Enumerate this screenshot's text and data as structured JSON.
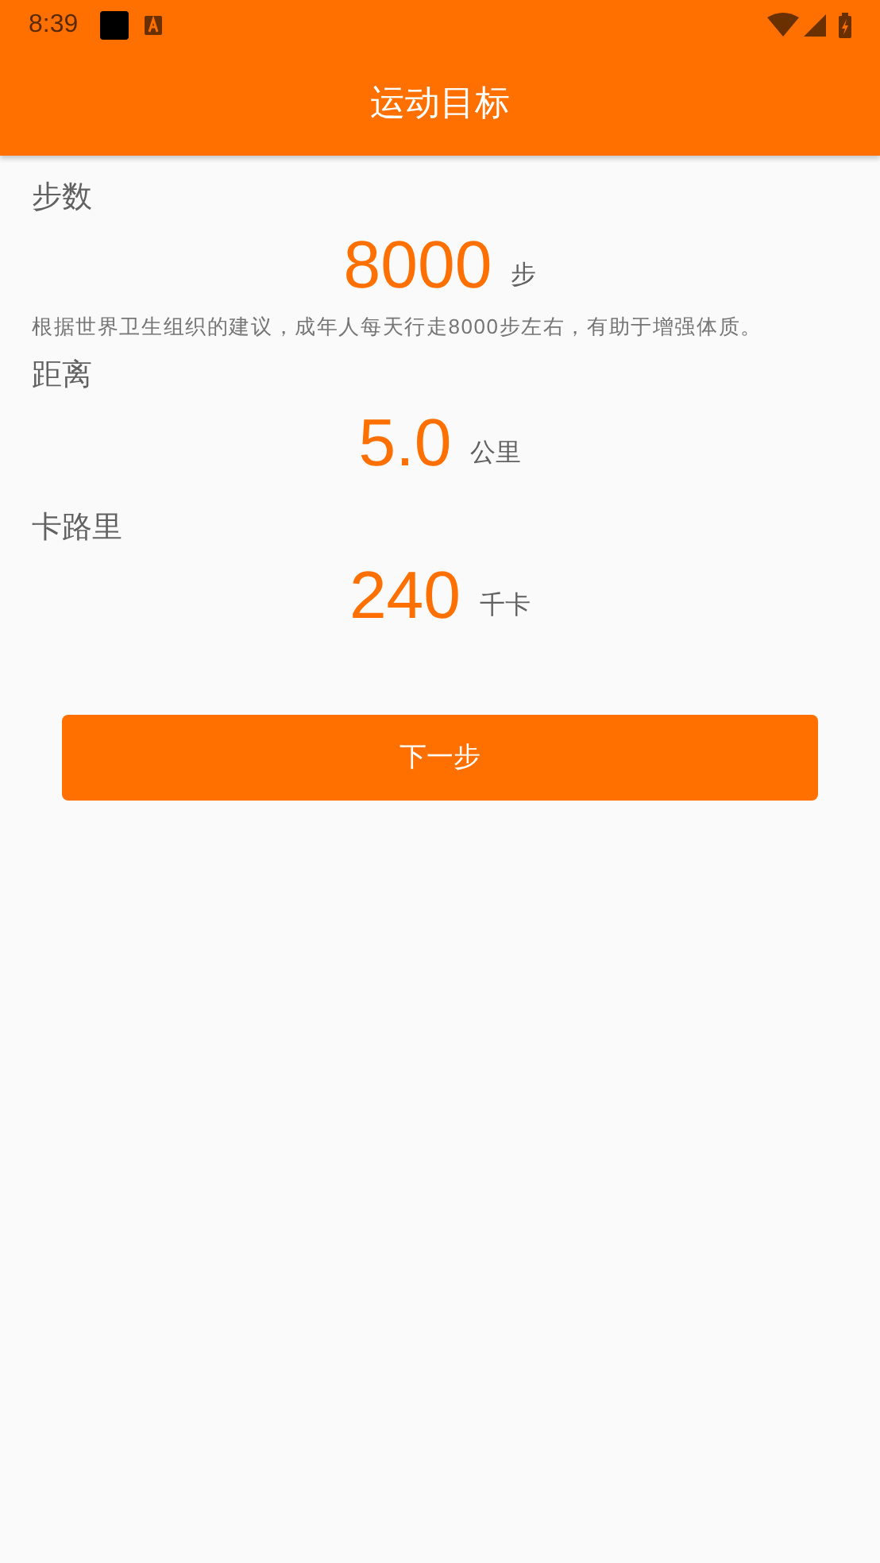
{
  "status_bar": {
    "time": "8:39"
  },
  "app_bar": {
    "title": "运动目标"
  },
  "goals": [
    {
      "label": "步数",
      "value": "8000",
      "unit": "步",
      "note": "根据世界卫生组织的建议，成年人每天行走8000步左右，有助于增强体质。"
    },
    {
      "label": "距离",
      "value": "5.0",
      "unit": "公里"
    },
    {
      "label": "卡路里",
      "value": "240",
      "unit": "千卡"
    }
  ],
  "button": {
    "label": "下一步"
  }
}
